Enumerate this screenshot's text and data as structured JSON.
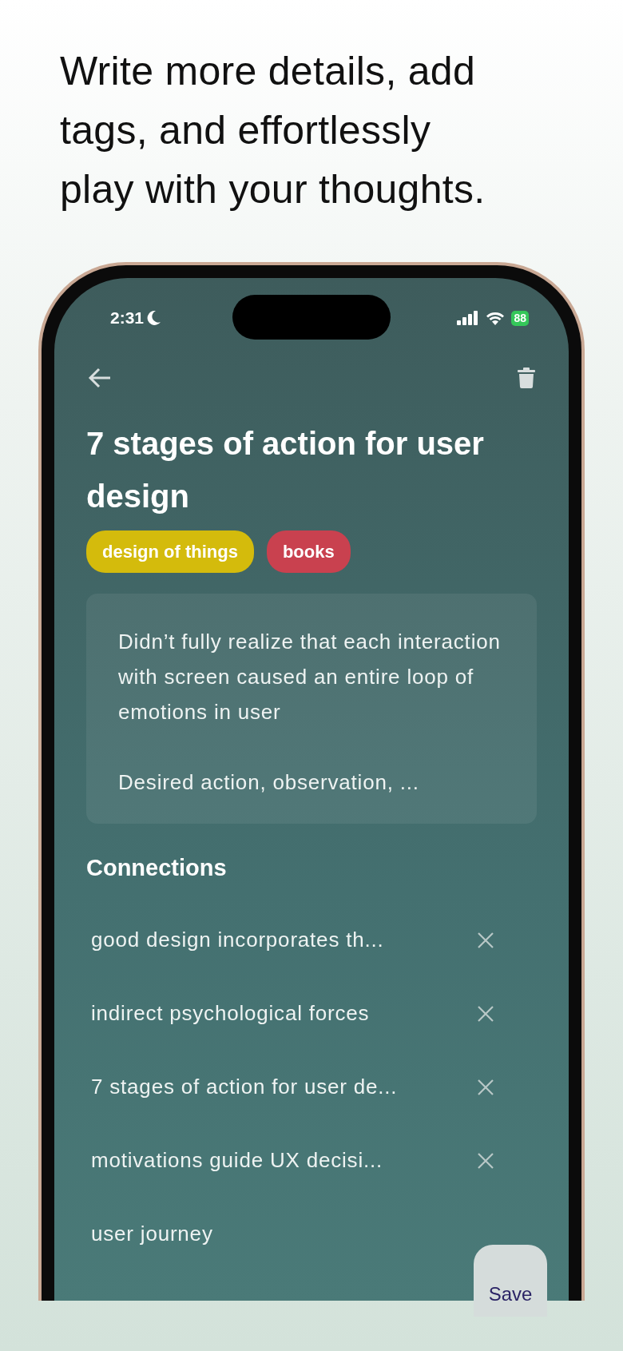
{
  "headline": "Write more details, add tags, and effortlessly play with your thoughts.",
  "status_bar": {
    "time": "2:31",
    "battery": "88"
  },
  "note": {
    "title": "7 stages of action for user design",
    "tags": [
      {
        "label": "design of things",
        "color": "#d4bb0c"
      },
      {
        "label": "books",
        "color": "#c9414f"
      }
    ],
    "body": [
      "Didn’t fully realize that each interaction with screen caused an entire loop of emotions in user",
      "Desired action, observation, ..."
    ]
  },
  "connections": {
    "heading": "Connections",
    "items": [
      {
        "label": "good design incorporates th...",
        "kind": "removable"
      },
      {
        "label": "indirect psychological forces",
        "kind": "removable"
      },
      {
        "label": "7 stages of action for user de...",
        "kind": "removable"
      },
      {
        "label": "motivations guide UX decisi...",
        "kind": "removable"
      },
      {
        "label": "user journey",
        "kind": "plain"
      }
    ]
  },
  "save_button": "Save"
}
